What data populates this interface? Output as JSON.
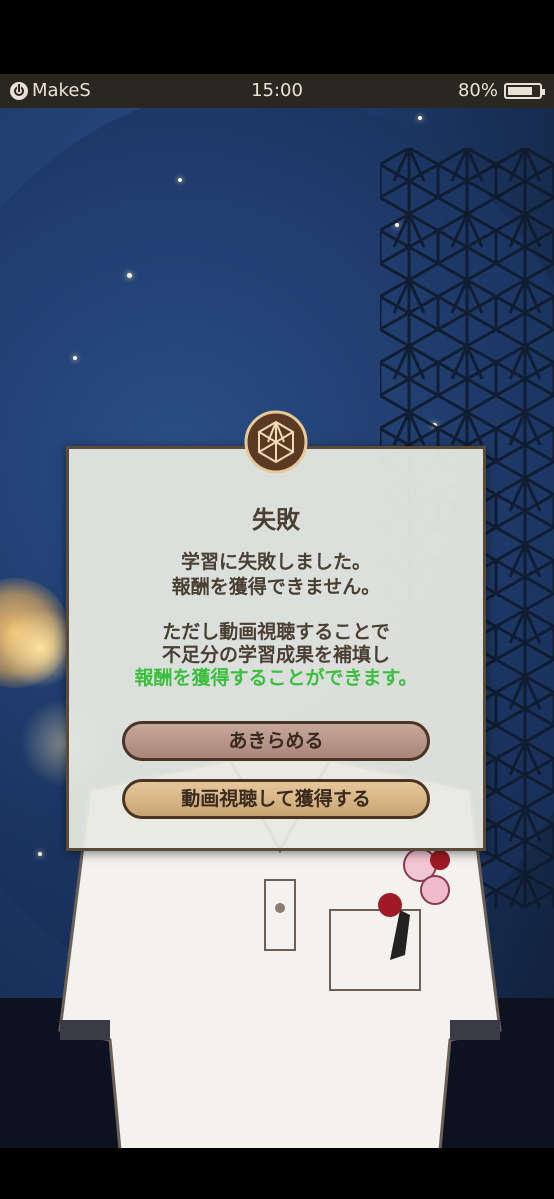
{
  "status_bar": {
    "app_name": "MakeS",
    "time": "15:00",
    "battery_percent": "80%",
    "battery_level": 0.8
  },
  "dialog": {
    "title": "失敗",
    "message_line1": "学習に失敗しました。",
    "message_line2": "報酬を獲得できません。",
    "info_line1": "ただし動画視聴することで",
    "info_line2": "不足分の学習成果を補填し",
    "info_line3_highlight": "報酬を獲得することができます。",
    "giveup_label": "あきらめる",
    "watch_label": "動画視聴して獲得する"
  },
  "colors": {
    "highlight_green": "#3bbf3e",
    "dialog_text": "#4a3f33",
    "giveup_button": "#b8958a",
    "watch_button": "#dcbb8a",
    "status_bar_bg": "#2a2620"
  },
  "icons": [
    "power-icon",
    "battery-icon",
    "asanoha-emblem-icon"
  ]
}
